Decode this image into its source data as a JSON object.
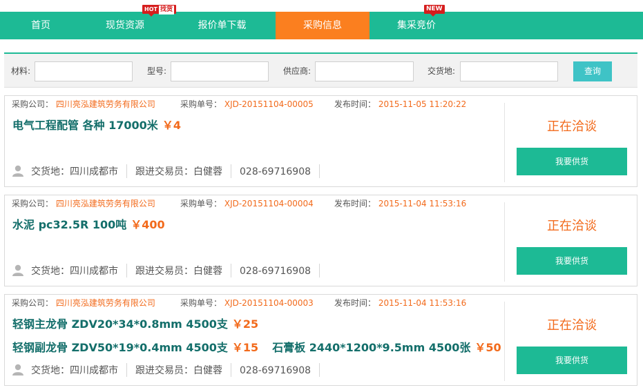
{
  "nav": {
    "items": [
      {
        "label": "首页"
      },
      {
        "label": "现货资源",
        "badge_prefix": "HOT",
        "badge_text": "找货"
      },
      {
        "label": "报价单下载"
      },
      {
        "label": "采购信息",
        "active": true
      },
      {
        "label": "集采竞价",
        "badge_text": "NEW"
      }
    ]
  },
  "search": {
    "material_label": "材料:",
    "model_label": "型号:",
    "supplier_label": "供应商:",
    "delivery_label": "交货地:",
    "material_value": "",
    "model_value": "",
    "supplier_value": "",
    "delivery_value": "",
    "submit_label": "查询"
  },
  "labels": {
    "company": "采购公司：",
    "order_no": "采购单号：",
    "publish_time": "发布时间：",
    "delivery": "交货地：",
    "trader": "跟进交易员：",
    "status": "正在洽谈",
    "supply_button": "我要供货"
  },
  "colors": {
    "nav": "#1dba95",
    "active": "#fb7f1f",
    "accent": "#f26a1b",
    "title": "#136e6a",
    "button": "#3fc3c6"
  },
  "listings": [
    {
      "company": "四川亮泓建筑劳务有限公司",
      "order_no": "XJD-20151104-00005",
      "publish_time": "2015-11-05 11:20:22",
      "lines": [
        [
          {
            "name": "电气工程配管 各种 17000米",
            "price": "￥4"
          }
        ]
      ],
      "delivery": "四川成都市",
      "trader": "白健蓉",
      "phone": "028-69716908"
    },
    {
      "company": "四川亮泓建筑劳务有限公司",
      "order_no": "XJD-20151104-00004",
      "publish_time": "2015-11-04 11:53:16",
      "lines": [
        [
          {
            "name": "水泥 pc32.5R 100吨",
            "price": "￥400"
          }
        ]
      ],
      "delivery": "四川成都市",
      "trader": "白健蓉",
      "phone": "028-69716908"
    },
    {
      "company": "四川亮泓建筑劳务有限公司",
      "order_no": "XJD-20151104-00003",
      "publish_time": "2015-11-04 11:53:16",
      "lines": [
        [
          {
            "name": "轻钢主龙骨 ZDV20*34*0.8mm 4500支",
            "price": "￥25"
          }
        ],
        [
          {
            "name": "轻钢副龙骨 ZDV50*19*0.4mm 4500支",
            "price": "￥15"
          },
          {
            "name": "石膏板 2440*1200*9.5mm 4500张",
            "price": "￥50"
          }
        ]
      ],
      "delivery": "四川成都市",
      "trader": "白健蓉",
      "phone": "028-69716908"
    }
  ]
}
